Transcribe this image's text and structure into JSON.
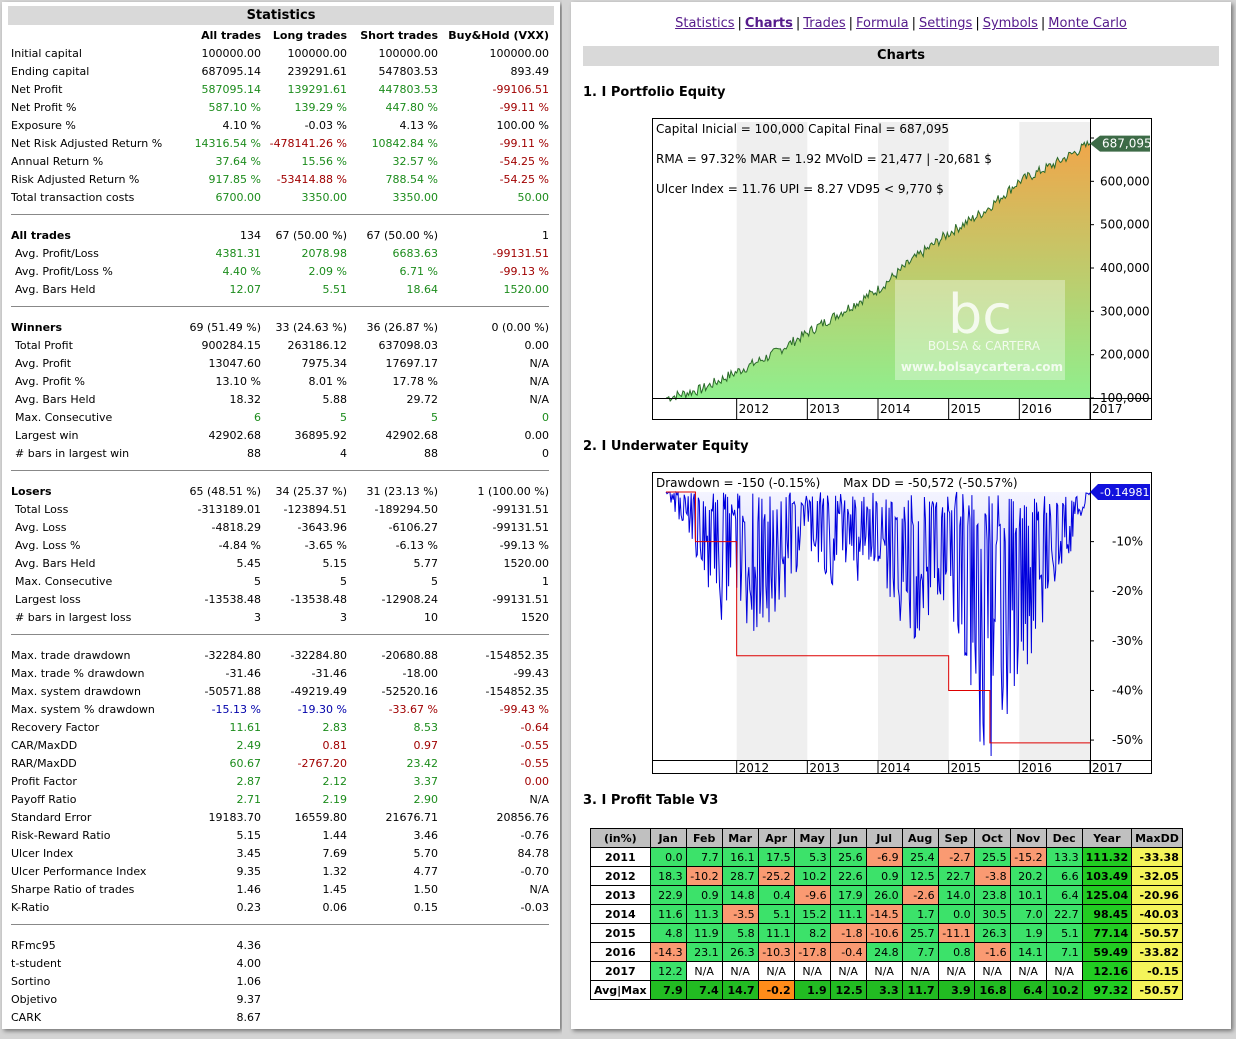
{
  "statistics": {
    "title": "Statistics",
    "headers": [
      "All trades",
      "Long trades",
      "Short trades",
      "Buy&Hold (VXX)"
    ],
    "rows": [
      {
        "label": "Initial capital",
        "v": [
          "100000.00",
          "100000.00",
          "100000.00",
          "100000.00"
        ],
        "c": [
          "",
          "",
          "",
          ""
        ]
      },
      {
        "label": "Ending capital",
        "v": [
          "687095.14",
          "239291.61",
          "547803.53",
          "893.49"
        ],
        "c": [
          "",
          "",
          "",
          ""
        ]
      },
      {
        "label": "Net Profit",
        "v": [
          "587095.14",
          "139291.61",
          "447803.53",
          "-99106.51"
        ],
        "c": [
          "g",
          "g",
          "g",
          "r"
        ]
      },
      {
        "label": "Net Profit %",
        "v": [
          "587.10 %",
          "139.29 %",
          "447.80 %",
          "-99.11 %"
        ],
        "c": [
          "g",
          "g",
          "g",
          "r"
        ]
      },
      {
        "label": "Exposure %",
        "v": [
          "4.10 %",
          "-0.03 %",
          "4.13 %",
          "100.00 %"
        ],
        "c": [
          "",
          "",
          "",
          ""
        ]
      },
      {
        "label": "Net Risk Adjusted Return %",
        "v": [
          "14316.54 %",
          "-478141.26 %",
          "10842.84 %",
          "-99.11 %"
        ],
        "c": [
          "g",
          "r",
          "g",
          "r"
        ]
      },
      {
        "label": "Annual Return %",
        "v": [
          "37.64 %",
          "15.56 %",
          "32.57 %",
          "-54.25 %"
        ],
        "c": [
          "g",
          "g",
          "g",
          "r"
        ]
      },
      {
        "label": "Risk Adjusted Return %",
        "v": [
          "917.85 %",
          "-53414.88 %",
          "788.54 %",
          "-54.25 %"
        ],
        "c": [
          "g",
          "r",
          "g",
          "r"
        ]
      },
      {
        "label": "Total transaction costs",
        "v": [
          "6700.00",
          "3350.00",
          "3350.00",
          "50.00"
        ],
        "c": [
          "g",
          "g",
          "g",
          "g"
        ]
      },
      {
        "sep": true
      },
      {
        "label": "All trades",
        "v": [
          "134",
          "67 (50.00 %)",
          "67 (50.00 %)",
          "1"
        ],
        "c": [
          "",
          "",
          "",
          ""
        ],
        "bold": true
      },
      {
        "label": " Avg. Profit/Loss",
        "v": [
          "4381.31",
          "2078.98",
          "6683.63",
          "-99131.51"
        ],
        "c": [
          "g",
          "g",
          "g",
          "r"
        ]
      },
      {
        "label": " Avg. Profit/Loss %",
        "v": [
          "4.40 %",
          "2.09 %",
          "6.71 %",
          "-99.13 %"
        ],
        "c": [
          "g",
          "g",
          "g",
          "r"
        ]
      },
      {
        "label": " Avg. Bars Held",
        "v": [
          "12.07",
          "5.51",
          "18.64",
          "1520.00"
        ],
        "c": [
          "g",
          "g",
          "g",
          "g"
        ]
      },
      {
        "sep": true
      },
      {
        "label": "Winners",
        "v": [
          "69 (51.49 %)",
          "33 (24.63 %)",
          "36 (26.87 %)",
          "0 (0.00 %)"
        ],
        "c": [
          "",
          "",
          "",
          ""
        ],
        "bold": true
      },
      {
        "label": " Total Profit",
        "v": [
          "900284.15",
          "263186.12",
          "637098.03",
          "0.00"
        ],
        "c": [
          "",
          "",
          "",
          ""
        ]
      },
      {
        "label": " Avg. Profit",
        "v": [
          "13047.60",
          "7975.34",
          "17697.17",
          "N/A"
        ],
        "c": [
          "",
          "",
          "",
          ""
        ]
      },
      {
        "label": " Avg. Profit %",
        "v": [
          "13.10 %",
          "8.01 %",
          "17.78 %",
          "N/A"
        ],
        "c": [
          "",
          "",
          "",
          ""
        ]
      },
      {
        "label": " Avg. Bars Held",
        "v": [
          "18.32",
          "5.88",
          "29.72",
          "N/A"
        ],
        "c": [
          "",
          "",
          "",
          ""
        ]
      },
      {
        "label": " Max. Consecutive",
        "v": [
          "6",
          "5",
          "5",
          "0"
        ],
        "c": [
          "g",
          "g",
          "g",
          "g"
        ]
      },
      {
        "label": " Largest win",
        "v": [
          "42902.68",
          "36895.92",
          "42902.68",
          "0.00"
        ],
        "c": [
          "",
          "",
          "",
          ""
        ]
      },
      {
        "label": " # bars in largest win",
        "v": [
          "88",
          "4",
          "88",
          "0"
        ],
        "c": [
          "",
          "",
          "",
          ""
        ]
      },
      {
        "sep": true
      },
      {
        "label": "Losers",
        "v": [
          "65 (48.51 %)",
          "34 (25.37 %)",
          "31 (23.13 %)",
          "1 (100.00 %)"
        ],
        "c": [
          "",
          "",
          "",
          ""
        ],
        "bold": true
      },
      {
        "label": " Total Loss",
        "v": [
          "-313189.01",
          "-123894.51",
          "-189294.50",
          "-99131.51"
        ],
        "c": [
          "",
          "",
          "",
          ""
        ]
      },
      {
        "label": " Avg. Loss",
        "v": [
          "-4818.29",
          "-3643.96",
          "-6106.27",
          "-99131.51"
        ],
        "c": [
          "",
          "",
          "",
          ""
        ]
      },
      {
        "label": " Avg. Loss %",
        "v": [
          "-4.84 %",
          "-3.65 %",
          "-6.13 %",
          "-99.13 %"
        ],
        "c": [
          "",
          "",
          "",
          ""
        ]
      },
      {
        "label": " Avg. Bars Held",
        "v": [
          "5.45",
          "5.15",
          "5.77",
          "1520.00"
        ],
        "c": [
          "",
          "",
          "",
          ""
        ]
      },
      {
        "label": " Max. Consecutive",
        "v": [
          "5",
          "5",
          "5",
          "1"
        ],
        "c": [
          "",
          "",
          "",
          ""
        ]
      },
      {
        "label": " Largest loss",
        "v": [
          "-13538.48",
          "-13538.48",
          "-12908.24",
          "-99131.51"
        ],
        "c": [
          "",
          "",
          "",
          ""
        ]
      },
      {
        "label": " # bars in largest loss",
        "v": [
          "3",
          "3",
          "10",
          "1520"
        ],
        "c": [
          "",
          "",
          "",
          ""
        ]
      },
      {
        "sep": true
      },
      {
        "label": "Max. trade drawdown",
        "v": [
          "-32284.80",
          "-32284.80",
          "-20680.88",
          "-154852.35"
        ],
        "c": [
          "",
          "",
          "",
          ""
        ]
      },
      {
        "label": "Max. trade % drawdown",
        "v": [
          "-31.46",
          "-31.46",
          "-18.00",
          "-99.43"
        ],
        "c": [
          "",
          "",
          "",
          ""
        ]
      },
      {
        "label": "Max. system drawdown",
        "v": [
          "-50571.88",
          "-49219.49",
          "-52520.16",
          "-154852.35"
        ],
        "c": [
          "",
          "",
          "",
          ""
        ]
      },
      {
        "label": "Max. system % drawdown",
        "v": [
          "-15.13 %",
          "-19.30 %",
          "-33.67 %",
          "-99.43 %"
        ],
        "c": [
          "b",
          "b",
          "r",
          "r"
        ]
      },
      {
        "label": "Recovery Factor",
        "v": [
          "11.61",
          "2.83",
          "8.53",
          "-0.64"
        ],
        "c": [
          "g",
          "g",
          "g",
          "r"
        ]
      },
      {
        "label": "CAR/MaxDD",
        "v": [
          "2.49",
          "0.81",
          "0.97",
          "-0.55"
        ],
        "c": [
          "g",
          "r",
          "r",
          "r"
        ]
      },
      {
        "label": "RAR/MaxDD",
        "v": [
          "60.67",
          "-2767.20",
          "23.42",
          "-0.55"
        ],
        "c": [
          "g",
          "r",
          "g",
          "r"
        ]
      },
      {
        "label": "Profit Factor",
        "v": [
          "2.87",
          "2.12",
          "3.37",
          "0.00"
        ],
        "c": [
          "g",
          "g",
          "g",
          "r"
        ]
      },
      {
        "label": "Payoff Ratio",
        "v": [
          "2.71",
          "2.19",
          "2.90",
          "N/A"
        ],
        "c": [
          "g",
          "g",
          "g",
          ""
        ]
      },
      {
        "label": "Standard Error",
        "v": [
          "19183.70",
          "16559.80",
          "21676.71",
          "20856.76"
        ],
        "c": [
          "",
          "",
          "",
          ""
        ]
      },
      {
        "label": "Risk-Reward Ratio",
        "v": [
          "5.15",
          "1.44",
          "3.46",
          "-0.76"
        ],
        "c": [
          "",
          "",
          "",
          ""
        ]
      },
      {
        "label": "Ulcer Index",
        "v": [
          "3.45",
          "7.69",
          "5.70",
          "84.78"
        ],
        "c": [
          "",
          "",
          "",
          ""
        ]
      },
      {
        "label": "Ulcer Performance Index",
        "v": [
          "9.35",
          "1.32",
          "4.77",
          "-0.70"
        ],
        "c": [
          "",
          "",
          "",
          ""
        ]
      },
      {
        "label": "Sharpe Ratio of trades",
        "v": [
          "1.46",
          "1.45",
          "1.50",
          "N/A"
        ],
        "c": [
          "",
          "",
          "",
          ""
        ]
      },
      {
        "label": "K-Ratio",
        "v": [
          "0.23",
          "0.06",
          "0.15",
          "-0.03"
        ],
        "c": [
          "",
          "",
          "",
          ""
        ]
      },
      {
        "sep": true
      },
      {
        "label": "RFmc95",
        "v": [
          "4.36",
          "",
          "",
          ""
        ],
        "c": [
          "",
          "",
          "",
          ""
        ]
      },
      {
        "label": "t-student",
        "v": [
          "4.00",
          "",
          "",
          ""
        ],
        "c": [
          "",
          "",
          "",
          ""
        ]
      },
      {
        "label": "Sortino",
        "v": [
          "1.06",
          "",
          "",
          ""
        ],
        "c": [
          "",
          "",
          "",
          ""
        ]
      },
      {
        "label": "Objetivo",
        "v": [
          "9.37",
          "",
          "",
          ""
        ],
        "c": [
          "",
          "",
          "",
          ""
        ]
      },
      {
        "label": "CARK",
        "v": [
          "8.67",
          "",
          "",
          ""
        ],
        "c": [
          "",
          "",
          "",
          ""
        ]
      }
    ]
  },
  "nav": {
    "items": [
      "Statistics",
      "Charts",
      "Trades",
      "Formula",
      "Settings",
      "Symbols",
      "Monte Carlo"
    ],
    "current": "Charts"
  },
  "charts_header": "Charts",
  "section1": "1. I Portfolio Equity",
  "section2": "2. I Underwater Equity",
  "section3": "3. I Profit Table V3",
  "equity_text": {
    "line1": "Capital Inicial = 100,000  Capital Final = 687,095",
    "line2": "RMA = 97.32%   MAR = 1.92   MVolD = 21,477 | -20,681 $",
    "line3": "Ulcer Index = 11.76   UPI = 8.27   VD95 < 9,770 $",
    "last_value": "687,095",
    "watermark_logo": "bc",
    "watermark_name": "BOLSA & CARTERA",
    "watermark_url": "www.bolsaycartera.com"
  },
  "underwater_text": {
    "line1": "Drawdown = -150 (-0.15%)      Max DD = -50,572 (-50.57%)",
    "last_value": "-0.14981"
  },
  "chart_data": [
    {
      "type": "area",
      "x": [
        "2011-01",
        "2011-07",
        "2012-01",
        "2012-07",
        "2013-01",
        "2013-07",
        "2014-01",
        "2014-07",
        "2015-01",
        "2015-07",
        "2016-01",
        "2016-07",
        "2017-01"
      ],
      "y": [
        100000,
        120000,
        160000,
        200000,
        250000,
        300000,
        350000,
        420000,
        480000,
        530000,
        600000,
        640000,
        687095
      ],
      "x_tick_labels": [
        "2012",
        "2013",
        "2014",
        "2015",
        "2016",
        "2017"
      ],
      "y_tick_labels": [
        "100,000",
        "200,000",
        "300,000",
        "400,000",
        "500,000",
        "600,000",
        "700,000"
      ],
      "ylim": [
        100000,
        700000
      ]
    },
    {
      "type": "area",
      "x": [
        "2011-01",
        "2011-06",
        "2012-01",
        "2012-07",
        "2013-01",
        "2013-07",
        "2014-01",
        "2014-07",
        "2015-01",
        "2015-06",
        "2015-08",
        "2016-01",
        "2016-07",
        "2017-01"
      ],
      "y": [
        0,
        -12,
        -31,
        -25,
        -10,
        -20,
        -14,
        -30,
        -20,
        -45,
        -50.57,
        -35,
        -20,
        -0.15
      ],
      "max_dd_steps": [
        0,
        -10,
        -33,
        -33,
        -33,
        -33,
        -33,
        -33,
        -40,
        -40,
        -50.57,
        -50.57,
        -50.57,
        -50.57
      ],
      "x_tick_labels": [
        "2012",
        "2013",
        "2014",
        "2015",
        "2016",
        "2017"
      ],
      "y_tick_labels": [
        "-10%",
        "-20%",
        "-30%",
        "-40%",
        "-50%"
      ],
      "ylim": [
        -52,
        0
      ]
    },
    {
      "type": "table",
      "columns": [
        "(in%)",
        "Jan",
        "Feb",
        "Mar",
        "Apr",
        "May",
        "Jun",
        "Jul",
        "Aug",
        "Sep",
        "Oct",
        "Nov",
        "Dec",
        "Year",
        "MaxDD"
      ],
      "rows": [
        [
          "2011",
          "0.0",
          "7.7",
          "16.1",
          "17.5",
          "5.3",
          "25.6",
          "-6.9",
          "25.4",
          "-2.7",
          "25.5",
          "-15.2",
          "13.3",
          "111.32",
          "-33.38"
        ],
        [
          "2012",
          "18.3",
          "-10.2",
          "28.7",
          "-25.2",
          "10.2",
          "22.6",
          "0.9",
          "12.5",
          "22.7",
          "-3.8",
          "20.2",
          "6.6",
          "103.49",
          "-32.05"
        ],
        [
          "2013",
          "22.9",
          "0.9",
          "14.8",
          "0.4",
          "-9.6",
          "17.9",
          "26.0",
          "-2.6",
          "14.0",
          "23.8",
          "10.1",
          "6.4",
          "125.04",
          "-20.96"
        ],
        [
          "2014",
          "11.6",
          "11.3",
          "-3.5",
          "5.1",
          "15.2",
          "11.1",
          "-14.5",
          "1.7",
          "0.0",
          "30.5",
          "7.0",
          "22.7",
          "98.45",
          "-40.03"
        ],
        [
          "2015",
          "4.8",
          "11.9",
          "5.8",
          "11.1",
          "8.2",
          "-1.8",
          "-10.6",
          "25.7",
          "-11.1",
          "26.3",
          "1.9",
          "5.1",
          "77.14",
          "-50.57"
        ],
        [
          "2016",
          "-14.3",
          "23.1",
          "26.3",
          "-10.3",
          "-17.8",
          "-0.4",
          "24.8",
          "7.7",
          "0.8",
          "-1.6",
          "14.1",
          "7.1",
          "59.49",
          "-33.82"
        ],
        [
          "2017",
          "12.2",
          "N/A",
          "N/A",
          "N/A",
          "N/A",
          "N/A",
          "N/A",
          "N/A",
          "N/A",
          "N/A",
          "N/A",
          "N/A",
          "12.16",
          "-0.15"
        ],
        [
          "Avg|Max",
          "7.9",
          "7.4",
          "14.7",
          "-0.2",
          "1.9",
          "12.5",
          "3.3",
          "11.7",
          "3.9",
          "16.8",
          "6.4",
          "10.2",
          "97.32",
          "-50.57"
        ]
      ]
    }
  ],
  "colors": {
    "positive_cell": "#3ce26a",
    "negative_cell": "#fa9a72",
    "year_cell": "#22cc22",
    "maxdd_cell": "#f5f55a",
    "avg_cell": "#22bb22",
    "avg_neg": "#ff8c1a",
    "equity_fill_top": "#f0a64a",
    "equity_fill_bottom": "#8ef08e",
    "underwater_line": "#0000dd"
  }
}
